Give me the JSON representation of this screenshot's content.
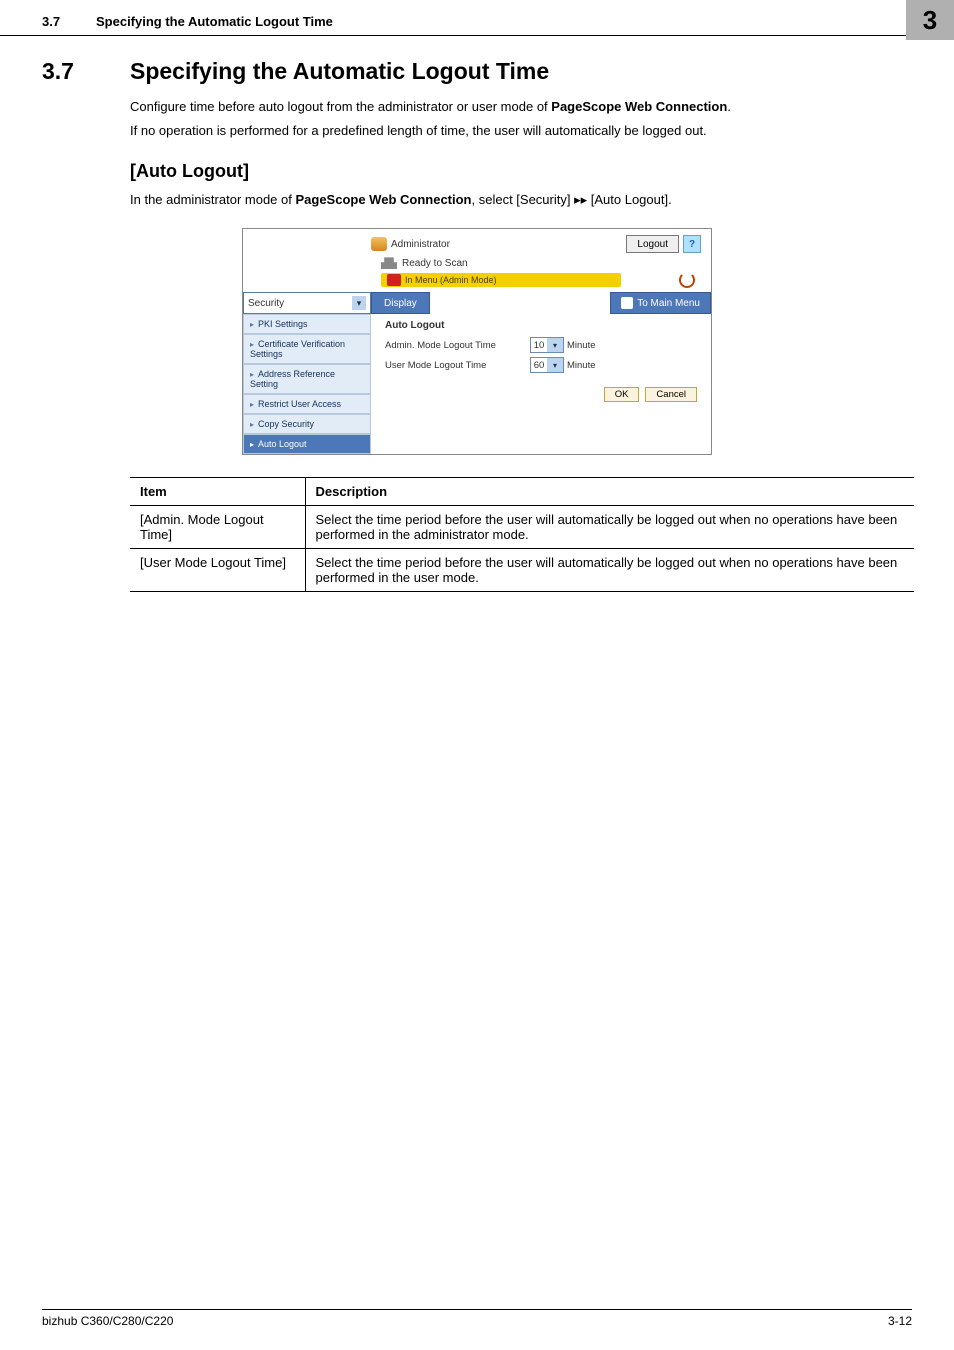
{
  "header": {
    "section_number": "3.7",
    "section_title": "Specifying the Automatic Logout Time",
    "chapter_badge": "3"
  },
  "main": {
    "heading_number": "3.7",
    "heading_title": "Specifying the Automatic Logout Time",
    "para1_a": "Configure time before auto logout from the administrator or user mode of ",
    "para1_b": "PageScope Web Connection",
    "para1_c": ".",
    "para2": "If no operation is performed for a predefined length of time, the user will automatically be logged out.",
    "sub_heading": "[Auto Logout]",
    "sub_para_a": "In the administrator mode of ",
    "sub_para_b": "PageScope Web Connection",
    "sub_para_c": ", select [Security] ▸▸ [Auto Logout]."
  },
  "screenshot": {
    "role_label": "Administrator",
    "logout_label": "Logout",
    "help_label": "?",
    "status_ready": "Ready to Scan",
    "status_mode": "In Menu (Admin Mode)",
    "category_select": "Security",
    "display_btn": "Display",
    "to_main_btn": "To Main Menu",
    "sidebar": {
      "items": [
        {
          "label": "PKI Settings"
        },
        {
          "label": "Certificate Verification Settings"
        },
        {
          "label": "Address Reference Setting"
        },
        {
          "label": "Restrict User Access"
        },
        {
          "label": "Copy Security"
        },
        {
          "label": "Auto Logout"
        }
      ]
    },
    "panel": {
      "title": "Auto Logout",
      "row1_label": "Admin. Mode Logout Time",
      "row1_value": "10",
      "row1_unit": "Minute",
      "row2_label": "User Mode Logout Time",
      "row2_value": "60",
      "row2_unit": "Minute",
      "ok_btn": "OK",
      "cancel_btn": "Cancel"
    }
  },
  "table": {
    "header_item": "Item",
    "header_desc": "Description",
    "rows": [
      {
        "item": "[Admin. Mode Logout Time]",
        "desc": "Select the time period before the user will automatically be logged out when no operations have been performed in the administrator mode."
      },
      {
        "item": "[User Mode Logout Time]",
        "desc": "Select the time period before the user will automatically be logged out when no operations have been performed in the user mode."
      }
    ]
  },
  "footer": {
    "left": "bizhub C360/C280/C220",
    "right": "3-12"
  }
}
